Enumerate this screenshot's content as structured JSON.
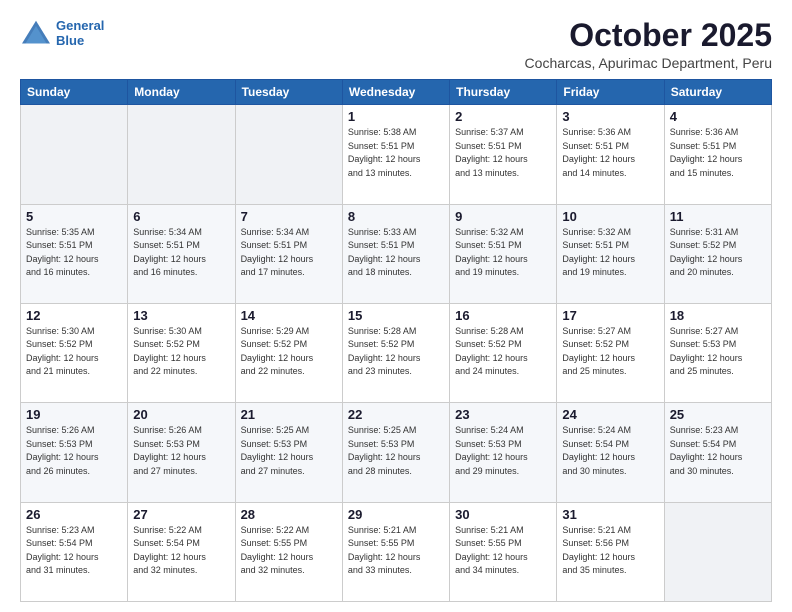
{
  "header": {
    "logo_line1": "General",
    "logo_line2": "Blue",
    "month": "October 2025",
    "location": "Cocharcas, Apurimac Department, Peru"
  },
  "weekdays": [
    "Sunday",
    "Monday",
    "Tuesday",
    "Wednesday",
    "Thursday",
    "Friday",
    "Saturday"
  ],
  "weeks": [
    [
      {
        "day": "",
        "info": ""
      },
      {
        "day": "",
        "info": ""
      },
      {
        "day": "",
        "info": ""
      },
      {
        "day": "1",
        "info": "Sunrise: 5:38 AM\nSunset: 5:51 PM\nDaylight: 12 hours\nand 13 minutes."
      },
      {
        "day": "2",
        "info": "Sunrise: 5:37 AM\nSunset: 5:51 PM\nDaylight: 12 hours\nand 13 minutes."
      },
      {
        "day": "3",
        "info": "Sunrise: 5:36 AM\nSunset: 5:51 PM\nDaylight: 12 hours\nand 14 minutes."
      },
      {
        "day": "4",
        "info": "Sunrise: 5:36 AM\nSunset: 5:51 PM\nDaylight: 12 hours\nand 15 minutes."
      }
    ],
    [
      {
        "day": "5",
        "info": "Sunrise: 5:35 AM\nSunset: 5:51 PM\nDaylight: 12 hours\nand 16 minutes."
      },
      {
        "day": "6",
        "info": "Sunrise: 5:34 AM\nSunset: 5:51 PM\nDaylight: 12 hours\nand 16 minutes."
      },
      {
        "day": "7",
        "info": "Sunrise: 5:34 AM\nSunset: 5:51 PM\nDaylight: 12 hours\nand 17 minutes."
      },
      {
        "day": "8",
        "info": "Sunrise: 5:33 AM\nSunset: 5:51 PM\nDaylight: 12 hours\nand 18 minutes."
      },
      {
        "day": "9",
        "info": "Sunrise: 5:32 AM\nSunset: 5:51 PM\nDaylight: 12 hours\nand 19 minutes."
      },
      {
        "day": "10",
        "info": "Sunrise: 5:32 AM\nSunset: 5:51 PM\nDaylight: 12 hours\nand 19 minutes."
      },
      {
        "day": "11",
        "info": "Sunrise: 5:31 AM\nSunset: 5:52 PM\nDaylight: 12 hours\nand 20 minutes."
      }
    ],
    [
      {
        "day": "12",
        "info": "Sunrise: 5:30 AM\nSunset: 5:52 PM\nDaylight: 12 hours\nand 21 minutes."
      },
      {
        "day": "13",
        "info": "Sunrise: 5:30 AM\nSunset: 5:52 PM\nDaylight: 12 hours\nand 22 minutes."
      },
      {
        "day": "14",
        "info": "Sunrise: 5:29 AM\nSunset: 5:52 PM\nDaylight: 12 hours\nand 22 minutes."
      },
      {
        "day": "15",
        "info": "Sunrise: 5:28 AM\nSunset: 5:52 PM\nDaylight: 12 hours\nand 23 minutes."
      },
      {
        "day": "16",
        "info": "Sunrise: 5:28 AM\nSunset: 5:52 PM\nDaylight: 12 hours\nand 24 minutes."
      },
      {
        "day": "17",
        "info": "Sunrise: 5:27 AM\nSunset: 5:52 PM\nDaylight: 12 hours\nand 25 minutes."
      },
      {
        "day": "18",
        "info": "Sunrise: 5:27 AM\nSunset: 5:53 PM\nDaylight: 12 hours\nand 25 minutes."
      }
    ],
    [
      {
        "day": "19",
        "info": "Sunrise: 5:26 AM\nSunset: 5:53 PM\nDaylight: 12 hours\nand 26 minutes."
      },
      {
        "day": "20",
        "info": "Sunrise: 5:26 AM\nSunset: 5:53 PM\nDaylight: 12 hours\nand 27 minutes."
      },
      {
        "day": "21",
        "info": "Sunrise: 5:25 AM\nSunset: 5:53 PM\nDaylight: 12 hours\nand 27 minutes."
      },
      {
        "day": "22",
        "info": "Sunrise: 5:25 AM\nSunset: 5:53 PM\nDaylight: 12 hours\nand 28 minutes."
      },
      {
        "day": "23",
        "info": "Sunrise: 5:24 AM\nSunset: 5:53 PM\nDaylight: 12 hours\nand 29 minutes."
      },
      {
        "day": "24",
        "info": "Sunrise: 5:24 AM\nSunset: 5:54 PM\nDaylight: 12 hours\nand 30 minutes."
      },
      {
        "day": "25",
        "info": "Sunrise: 5:23 AM\nSunset: 5:54 PM\nDaylight: 12 hours\nand 30 minutes."
      }
    ],
    [
      {
        "day": "26",
        "info": "Sunrise: 5:23 AM\nSunset: 5:54 PM\nDaylight: 12 hours\nand 31 minutes."
      },
      {
        "day": "27",
        "info": "Sunrise: 5:22 AM\nSunset: 5:54 PM\nDaylight: 12 hours\nand 32 minutes."
      },
      {
        "day": "28",
        "info": "Sunrise: 5:22 AM\nSunset: 5:55 PM\nDaylight: 12 hours\nand 32 minutes."
      },
      {
        "day": "29",
        "info": "Sunrise: 5:21 AM\nSunset: 5:55 PM\nDaylight: 12 hours\nand 33 minutes."
      },
      {
        "day": "30",
        "info": "Sunrise: 5:21 AM\nSunset: 5:55 PM\nDaylight: 12 hours\nand 34 minutes."
      },
      {
        "day": "31",
        "info": "Sunrise: 5:21 AM\nSunset: 5:56 PM\nDaylight: 12 hours\nand 35 minutes."
      },
      {
        "day": "",
        "info": ""
      }
    ]
  ]
}
